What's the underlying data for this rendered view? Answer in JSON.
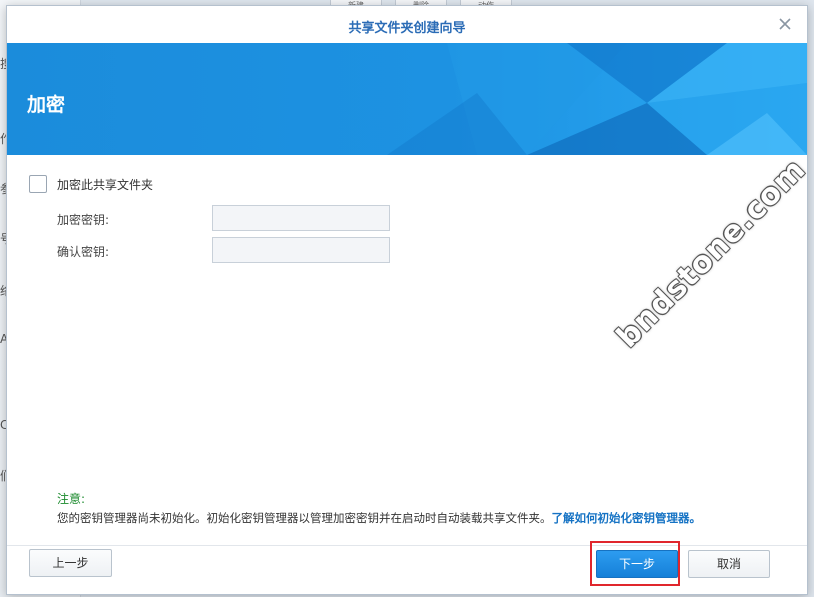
{
  "background": {
    "tabs": [
      "新建",
      "删除",
      "动作"
    ],
    "side_chars": [
      "搜",
      "作",
      "参",
      "号",
      "络",
      "A",
      "C",
      "们"
    ]
  },
  "dialog": {
    "title": "共享文件夹创建向导",
    "banner_title": "加密",
    "encrypt_checkbox_label": "加密此共享文件夹",
    "encrypt_checked": false,
    "key_label": "加密密钥:",
    "key_value": "",
    "confirm_label": "确认密钥:",
    "confirm_value": "",
    "note_title": "注意:",
    "note_text": "您的密钥管理器尚未初始化。初始化密钥管理器以管理加密密钥并在启动时自动装载共享文件夹。",
    "note_link": "了解如何初始化密钥管理器。",
    "buttons": {
      "prev": "上一步",
      "next": "下一步",
      "cancel": "取消"
    }
  },
  "watermark": "bndstone.com",
  "colors": {
    "banner": "#1a8ad8",
    "title": "#2b6cb6",
    "note_title": "#1b8a2d",
    "link": "#1673c4",
    "highlight": "#e0262c"
  }
}
